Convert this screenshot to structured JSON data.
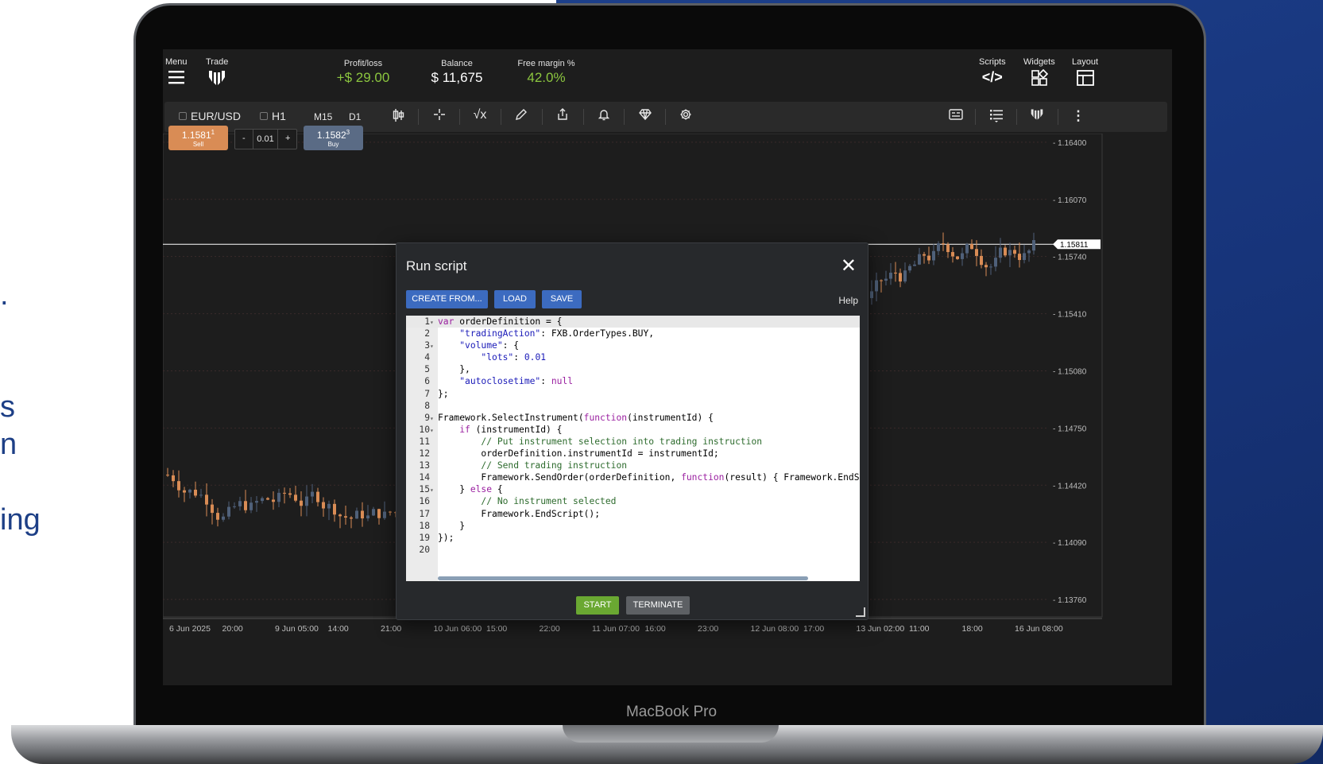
{
  "marketing": {
    "side_fragments": [
      ".",
      "s",
      "n",
      "ing"
    ]
  },
  "device": {
    "label": "MacBook Pro"
  },
  "topbar": {
    "menu_label": "Menu",
    "trade_label": "Trade",
    "profit_loss": {
      "label": "Profit/loss",
      "value": "+$ 29.00"
    },
    "balance": {
      "label": "Balance",
      "value": "$ 11,675"
    },
    "free_margin": {
      "label": "Free margin %",
      "value": "42.0%"
    },
    "scripts_label": "Scripts",
    "widgets_label": "Widgets",
    "layout_label": "Layout"
  },
  "toolbar": {
    "instrument": "EUR/USD",
    "timeframes": [
      "H1",
      "M15",
      "D1"
    ]
  },
  "trade_panel": {
    "sell": {
      "price_main": "1.1581",
      "price_sup": "1",
      "label": "Sell"
    },
    "lot": {
      "minus": "-",
      "value": "0.01",
      "plus": "+"
    },
    "buy": {
      "price_main": "1.1582",
      "price_sup": "3",
      "label": "Buy"
    }
  },
  "chart_data": {
    "type": "candlestick",
    "y_ticks": [
      "1.16400",
      "1.16070",
      "1.15740",
      "1.15410",
      "1.15080",
      "1.14750",
      "1.14420",
      "1.14090",
      "1.13760"
    ],
    "x_ticks": [
      "6 Jun 2025",
      "20:00",
      "9 Jun 05:00",
      "14:00",
      "21:00",
      "10 Jun 06:00",
      "15:00",
      "22:00",
      "11 Jun 07:00",
      "16:00",
      "23:00",
      "12 Jun 08:00",
      "17:00",
      "13 Jun 02:00",
      "11:00",
      "18:00",
      "16 Jun 08:00"
    ],
    "current_price": "1.15811",
    "colors": {
      "up": "#4f6079",
      "down": "#d98c55",
      "current_line": "#ffffff"
    },
    "ylim": [
      1.1365,
      1.1645
    ]
  },
  "dialog": {
    "title": "Run script",
    "buttons": {
      "create_from": "CREATE FROM...",
      "load": "LOAD",
      "save": "SAVE",
      "help": "Help",
      "start": "START",
      "terminate": "TERMINATE"
    },
    "code_lines": [
      "var orderDefinition = {",
      "    \"tradingAction\": FXB.OrderTypes.BUY,",
      "    \"volume\": {",
      "        \"lots\": 0.01",
      "    },",
      "    \"autoclosetime\": null",
      "};",
      "",
      "Framework.SelectInstrument(function(instrumentId) {",
      "    if (instrumentId) {",
      "        // Put instrument selection into trading instruction",
      "        orderDefinition.instrumentId = instrumentId;",
      "        // Send trading instruction",
      "        Framework.SendOrder(orderDefinition, function(result) { Framework.EndSc",
      "    } else {",
      "        // No instrument selected",
      "        Framework.EndScript();",
      "    }",
      "});",
      ""
    ],
    "fold_lines": [
      1,
      3,
      9,
      10,
      15
    ]
  }
}
